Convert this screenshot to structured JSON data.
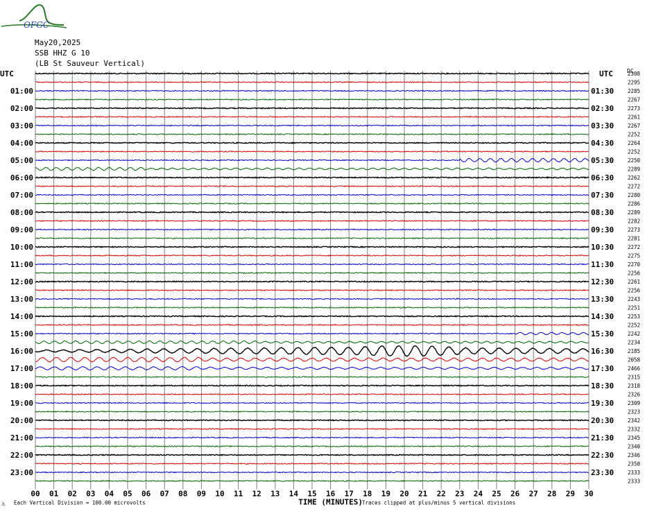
{
  "header": {
    "logo_text": "OFGC",
    "date": "May20,2025",
    "station": "SSB HHZ G 10",
    "station_name": "(LB St Sauveur Vertical)"
  },
  "chart_data": {
    "type": "line",
    "left_axis_title": "UTC",
    "right_axis_title": "UTC",
    "right_counts_title": "DC",
    "x_label": "TIME (MINUTES)",
    "x_ticks": [
      "00",
      "01",
      "02",
      "03",
      "04",
      "05",
      "06",
      "07",
      "08",
      "09",
      "10",
      "11",
      "12",
      "13",
      "14",
      "15",
      "16",
      "17",
      "18",
      "19",
      "20",
      "21",
      "22",
      "23",
      "24",
      "25",
      "26",
      "27",
      "28",
      "29",
      "30"
    ],
    "xlim": [
      0,
      30
    ],
    "left_hour_labels": [
      "01:00",
      "02:00",
      "03:00",
      "04:00",
      "05:00",
      "06:00",
      "07:00",
      "08:00",
      "09:00",
      "10:00",
      "11:00",
      "12:00",
      "13:00",
      "14:00",
      "15:00",
      "16:00",
      "17:00",
      "18:00",
      "19:00",
      "20:00",
      "21:00",
      "22:00",
      "23:00"
    ],
    "right_hour_labels": [
      "01:30",
      "02:30",
      "03:30",
      "04:30",
      "05:30",
      "06:30",
      "07:30",
      "08:30",
      "09:30",
      "10:30",
      "11:30",
      "12:30",
      "13:30",
      "14:30",
      "15:30",
      "16:30",
      "17:30",
      "18:30",
      "19:30",
      "20:30",
      "21:30",
      "22:30",
      "23:30"
    ],
    "dc_offsets": [
      2308,
      2295,
      2285,
      2267,
      2273,
      2261,
      2267,
      2252,
      2264,
      2252,
      2250,
      2289,
      2262,
      2272,
      2280,
      2286,
      2289,
      2282,
      2273,
      2281,
      2272,
      2275,
      2270,
      2256,
      2261,
      2256,
      2243,
      2251,
      2253,
      2252,
      2242,
      2234,
      2185,
      2058,
      2466,
      2315,
      2318,
      2326,
      2309,
      2323,
      2342,
      2332,
      2345,
      2340,
      2346,
      2350,
      2333,
      2333
    ],
    "trace_colors": [
      "#000000",
      "#d40000",
      "#0000c8",
      "#006400"
    ],
    "grid": true,
    "footer_left": "Each Vertical Division =  100.00 microvolts",
    "footer_right": "Traces clipped at plus/minus 5 vertical divisions",
    "footer_corner": "JL"
  }
}
